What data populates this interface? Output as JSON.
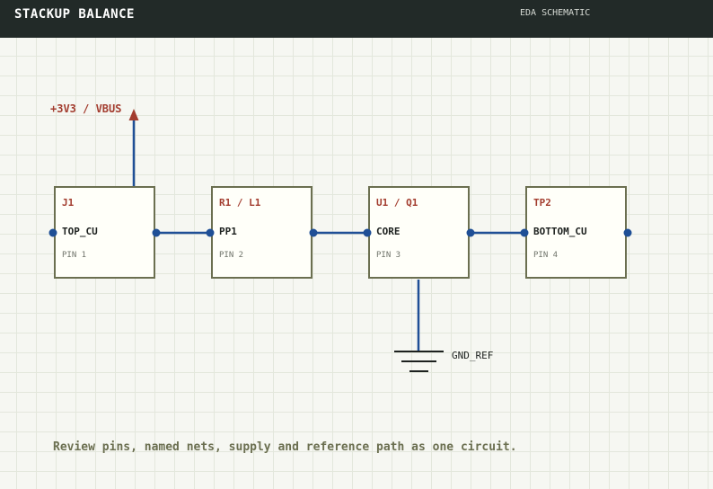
{
  "header": {
    "title": "STACKUP BALANCE",
    "tag": "EDA SCHEMATIC"
  },
  "schematic": {
    "supply_label": "+3V3 / VBUS",
    "ground_label": "GND_REF",
    "components": [
      {
        "ref": "J1",
        "net": "TOP_CU",
        "pin": "PIN 1"
      },
      {
        "ref": "R1 / L1",
        "net": "PP1",
        "pin": "PIN 2"
      },
      {
        "ref": "U1 / Q1",
        "net": "CORE",
        "pin": "PIN 3"
      },
      {
        "ref": "TP2",
        "net": "BOTTOM_CU",
        "pin": "PIN 4"
      }
    ]
  },
  "caption": "Review pins, named nets, supply and reference path as one circuit.",
  "colors": {
    "wire": "#1f4f96",
    "supply": "#a33d2f",
    "component_border": "#6b6f50",
    "ground": "#1d211f"
  }
}
